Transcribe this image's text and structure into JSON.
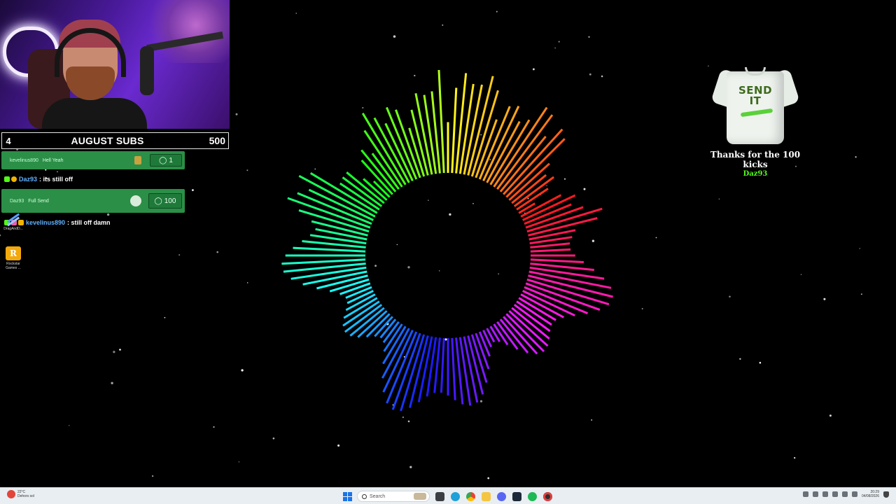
{
  "subs_goal": {
    "current": "4",
    "label": "AUGUST SUBS",
    "goal": "500"
  },
  "chat": {
    "gift1": {
      "user": "kevelinus890",
      "message": "Hell Yeah",
      "amount": "1"
    },
    "line1": {
      "user": "Daz93",
      "message": ": its still off"
    },
    "gift2": {
      "user": "Daz93",
      "message": "Full Send",
      "amount": "100"
    },
    "line2": {
      "user": "kevelinus890",
      "message": ": still off damn"
    }
  },
  "desktop_icons": [
    {
      "label": "DragAndD...",
      "icon": "drag-drop-icon"
    },
    {
      "label": "Rockstar Games ...",
      "icon": "rockstar-games-icon",
      "glyph": "R"
    }
  ],
  "alert": {
    "item": {
      "line1": "SEND",
      "line2": "IT"
    },
    "title": "Thanks for the 100 kicks",
    "user": "Daz93"
  },
  "taskbar": {
    "weather": {
      "temp": "22°C",
      "condition": "Dehors sol"
    },
    "search_placeholder": "Search",
    "clock": {
      "time": "20:29",
      "date": "04/08/2026"
    },
    "apps": [
      "file-explorer-icon",
      "edge-icon",
      "chrome-icon",
      "folder-icon",
      "discord-icon",
      "steam-icon",
      "spotify-icon",
      "obs-icon"
    ]
  },
  "colors": {
    "kick_green": "#53fc18",
    "card_green": "#2b8f47",
    "username_blue": "#5eb0ff",
    "background": "#000000"
  }
}
